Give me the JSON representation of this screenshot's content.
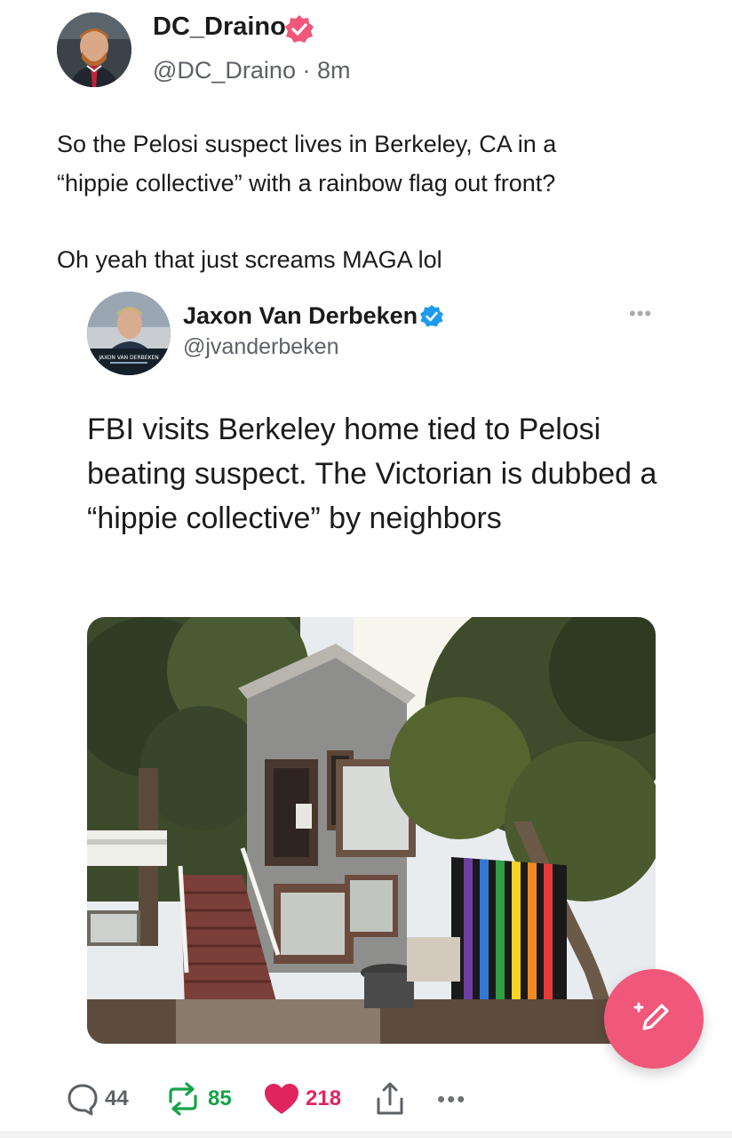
{
  "post": {
    "author": {
      "display_name": "DC_Draino",
      "handle_line": "@DC_Draino · 8m",
      "verified_color": "#f0577a"
    },
    "text_lines": [
      "So the Pelosi suspect lives in Berkeley, CA in a",
      "“hippie collective” with a rainbow flag out front?"
    ],
    "text_line_2": "Oh yeah that just screams MAGA lol"
  },
  "quote": {
    "author": {
      "display_name": "Jaxon Van Derbeken",
      "handle": "@jvanderbeken",
      "verified_color": "#1d9bf0",
      "avatar_caption": "JAXON VAN DERBEKEN"
    },
    "more_label": "•••",
    "text": "FBI visits Berkeley home tied to Pelosi beating suspect. The Victorian is dubbed a “hippie collective” by neighbors"
  },
  "actions": {
    "replies": "44",
    "reposts": "85",
    "likes": "218",
    "more_label": "•••"
  },
  "icons": {
    "reply": "reply-icon",
    "repost": "repost-icon",
    "like": "heart-icon",
    "share": "share-icon",
    "compose": "compose-icon"
  },
  "colors": {
    "accent_pink": "#f0577a",
    "like_red": "#e0245e",
    "repost_green": "#16a34a",
    "verified_blue": "#1d9bf0"
  }
}
